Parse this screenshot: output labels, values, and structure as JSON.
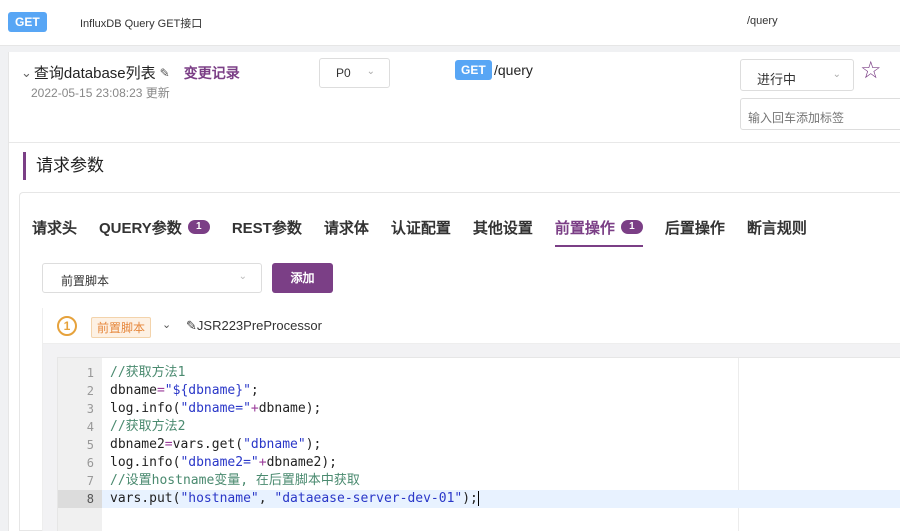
{
  "topbar": {
    "method": "GET",
    "name": "InfluxDB Query GET接口",
    "path": "/query"
  },
  "header": {
    "title": "查询database列表",
    "history_link": "变更记录",
    "updated": "2022-05-15 23:08:23 更新",
    "priority": "P0",
    "method": "GET",
    "path": "/query",
    "status": "进行中",
    "tag_placeholder": "输入回车添加标签"
  },
  "section": {
    "title": "请求参数"
  },
  "tabs": [
    {
      "label": "请求头"
    },
    {
      "label": "QUERY参数",
      "badge": "1"
    },
    {
      "label": "REST参数"
    },
    {
      "label": "请求体"
    },
    {
      "label": "认证配置"
    },
    {
      "label": "其他设置"
    },
    {
      "label": "前置操作",
      "badge": "1",
      "active": true
    },
    {
      "label": "后置操作"
    },
    {
      "label": "断言规则"
    }
  ],
  "toolbar": {
    "script_select": "前置脚本",
    "add_label": "添加"
  },
  "processor": {
    "index": "1",
    "tag": "前置脚本",
    "name": "JSR223PreProcessor"
  },
  "code_lines": [
    {
      "no": "1",
      "text": "//获取方法1"
    },
    {
      "no": "2",
      "text": "dbname=\"${dbname}\";"
    },
    {
      "no": "3",
      "text": "log.info(\"dbname=\"+dbname);"
    },
    {
      "no": "4",
      "text": "//获取方法2"
    },
    {
      "no": "5",
      "text": "dbname2=vars.get(\"dbname\");"
    },
    {
      "no": "6",
      "text": "log.info(\"dbname2=\"+dbname2);"
    },
    {
      "no": "7",
      "text": "//设置hostname变量, 在后置脚本中获取"
    },
    {
      "no": "8",
      "text": "vars.put(\"hostname\", \"dataease-server-dev-01\");"
    }
  ],
  "colors": {
    "accent": "#7b3f86",
    "method_get": "#58a6f5",
    "warning": "#e6a23c"
  }
}
